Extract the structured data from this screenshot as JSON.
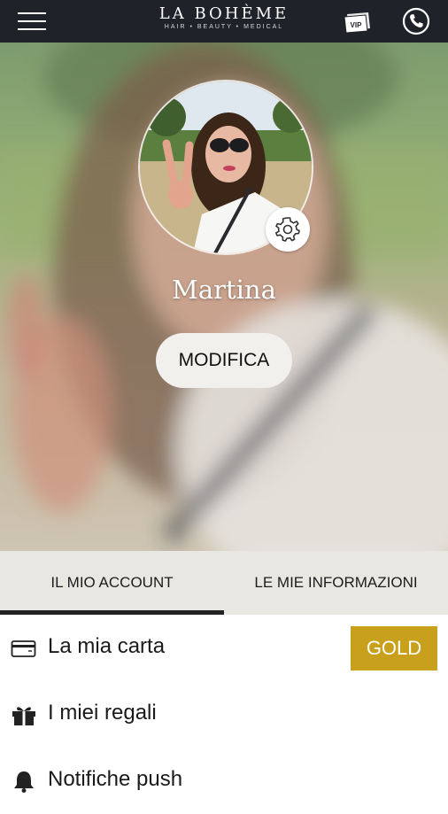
{
  "header": {
    "brand_title": "LA BOHÈME",
    "brand_subtitle": "HAIR • BEAUTY • MEDICAL",
    "vip_label": "VIP",
    "icons": [
      "menu-icon",
      "vip-ticket-icon",
      "phone-icon"
    ]
  },
  "profile": {
    "name": "Martina",
    "edit_label": "MODIFICA",
    "settings_icon": "gear-icon"
  },
  "tabs": [
    {
      "label": "IL MIO ACCOUNT",
      "active": true
    },
    {
      "label": "LE MIE INFORMAZIONI",
      "active": false
    }
  ],
  "menu": {
    "items": [
      {
        "label": "La mia carta",
        "icon": "card-icon",
        "badge": "GOLD"
      },
      {
        "label": "I miei regali",
        "icon": "gift-icon"
      },
      {
        "label": "Notifiche push",
        "icon": "bell-icon"
      }
    ]
  },
  "colors": {
    "topbar": "#1f2229",
    "tab_bar": "#e8e7e2",
    "gold": "#c9a01c",
    "button_bg": "#f1f0ec"
  }
}
